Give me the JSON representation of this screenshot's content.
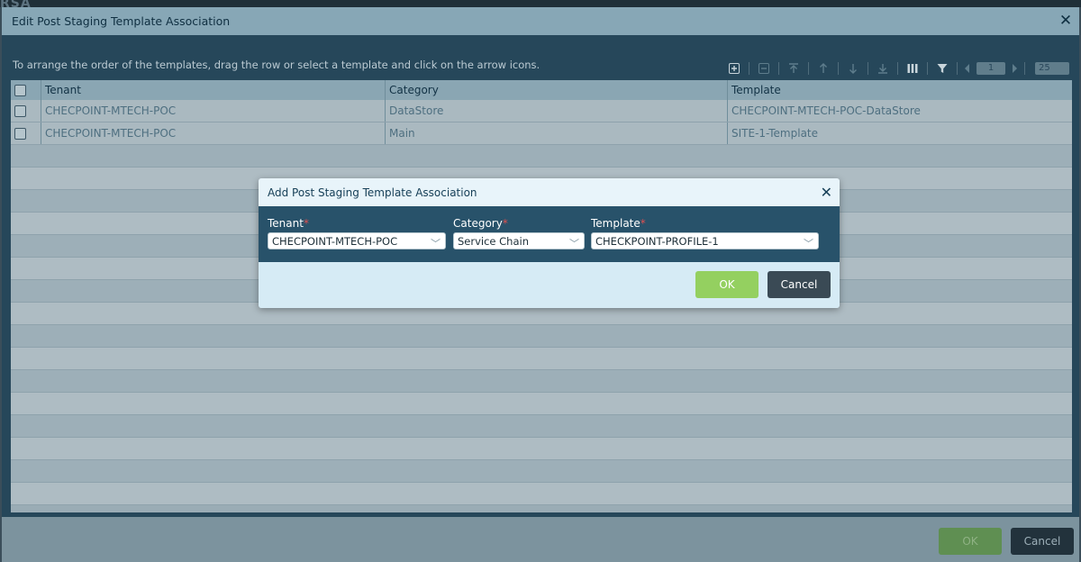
{
  "background": {
    "logo": "RSA"
  },
  "outer_dialog": {
    "title": "Edit Post Staging Template Association",
    "hint": "To arrange the order of the templates, drag the row or select a template and click on the arrow icons.",
    "toolbar": {
      "page": "1",
      "page_size": "25"
    },
    "columns": [
      "Tenant",
      "Category",
      "Template"
    ],
    "rows": [
      {
        "tenant": "CHECPOINT-MTECH-POC",
        "category": "DataStore",
        "template": "CHECPOINT-MTECH-POC-DataStore"
      },
      {
        "tenant": "CHECPOINT-MTECH-POC",
        "category": "Main",
        "template": "SITE-1-Template"
      }
    ],
    "ok_label": "OK",
    "cancel_label": "Cancel"
  },
  "modal": {
    "title": "Add Post Staging Template Association",
    "fields": {
      "tenant": {
        "label": "Tenant",
        "value": "CHECPOINT-MTECH-POC"
      },
      "category": {
        "label": "Category",
        "value": "Service Chain"
      },
      "template": {
        "label": "Template",
        "value": "CHECKPOINT-PROFILE-1"
      }
    },
    "required_mark": "*",
    "ok_label": "OK",
    "cancel_label": "Cancel"
  },
  "colors": {
    "ok_button": "#94d060",
    "cancel_button": "#3a4a55",
    "required": "#e05050"
  }
}
